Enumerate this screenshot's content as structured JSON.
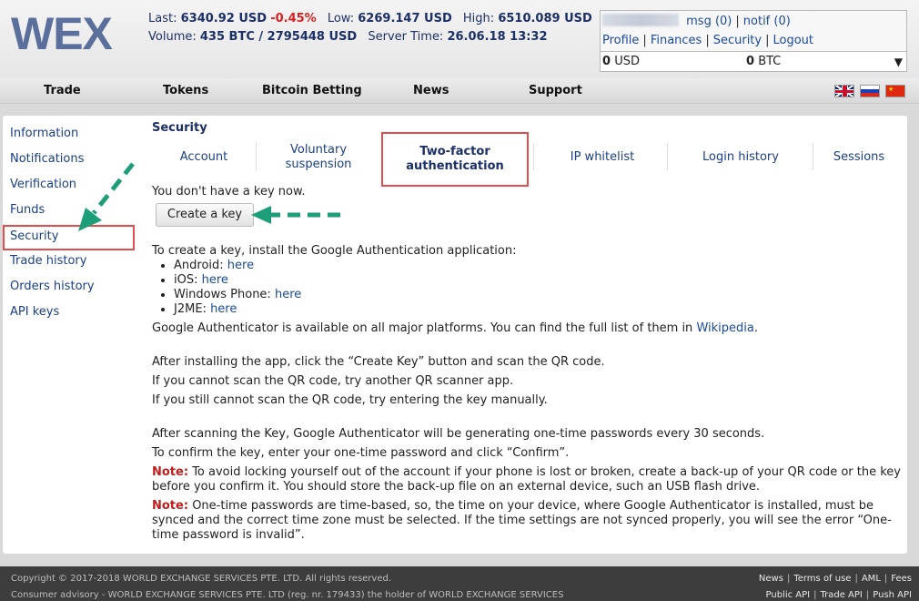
{
  "logo": "WEX",
  "ticker": {
    "last_label": "Last:",
    "last_value": "6340.92 USD",
    "change": "-0.45%",
    "low_label": "Low:",
    "low_value": "6269.147 USD",
    "high_label": "High:",
    "high_value": "6510.089 USD",
    "volume_label": "Volume:",
    "volume_value": "435 BTC / 2795448 USD",
    "server_label": "Server Time:",
    "server_value": "26.06.18 13:32"
  },
  "user": {
    "msg": "msg (0)",
    "notif": "notif (0)",
    "profile": "Profile",
    "finances": "Finances",
    "security": "Security",
    "logout": "Logout",
    "usd_amount": "0",
    "usd_unit": "USD",
    "btc_amount": "0",
    "btc_unit": "BTC"
  },
  "nav": {
    "trade": "Trade",
    "tokens": "Tokens",
    "bitcoin_betting": "Bitcoin Betting",
    "news": "News",
    "support": "Support"
  },
  "sidebar": {
    "items": [
      "Information",
      "Notifications",
      "Verification",
      "Funds",
      "Security",
      "Trade history",
      "Orders history",
      "API keys"
    ]
  },
  "section_title": "Security",
  "tabs": {
    "account": "Account",
    "voluntary": "Voluntary suspension",
    "twofactor": "Two-factor authentication",
    "ip": "IP whitelist",
    "login": "Login history",
    "sessions": "Sessions"
  },
  "no_key": "You don't have a key now.",
  "create_key": "Create a key",
  "content": {
    "intro": "To create a key, install the Google Authentication application:",
    "platforms": [
      {
        "name": "Android:",
        "link": "here"
      },
      {
        "name": "iOS:",
        "link": "here"
      },
      {
        "name": "Windows Phone:",
        "link": "here"
      },
      {
        "name": "J2ME:",
        "link": "here"
      }
    ],
    "available_pre": "Google Authenticator is available on all major platforms. You can find the full list of them in ",
    "available_link": "Wikipedia",
    "available_post": ".",
    "install_1": "After installing the app, click the “Create Key” button and scan the QR code.",
    "install_2": "If you cannot scan the QR code, try another QR scanner app.",
    "install_3": "If you still cannot scan the QR code, try entering the key manually.",
    "scan_1": "After scanning the Key, Google Authenticator will be generating one-time passwords every 30 seconds.",
    "scan_2": "To confirm the key, enter your one-time password and click “Confirm”.",
    "note_label": "Note:",
    "note_1": "To avoid locking yourself out of the account if your phone is lost or broken, create a back-up of your QR code or the key before you confirm it. You should store the back-up file on an external device, such an USB flash drive.",
    "note_2": "One-time passwords are time-based, so, the time on your device, where Google Authenticator is installed, must be synced and the correct time zone must be selected. If the time settings are not synced properly, you will see the error “One-time password is invalid”."
  },
  "footer": {
    "copyright": "Copyright © 2017-2018 WORLD EXCHANGE SERVICES PTE. LTD. All rights reserved.",
    "advisory": "Consumer advisory - WORLD EXCHANGE SERVICES PTE. LTD (reg. nr. 179433) the holder of WORLD EXCHANGE SERVICES",
    "news": "News",
    "terms": "Terms of use",
    "aml": "AML",
    "fees": "Fees",
    "public_api": "Public API",
    "trade_api": "Trade API",
    "push_api": "Push API"
  },
  "colors": {
    "accent": "#1c2f66",
    "link": "#1a4a9c",
    "negative": "#d92020",
    "highlight": "#e34d4d",
    "annotation": "#1e9e78"
  }
}
